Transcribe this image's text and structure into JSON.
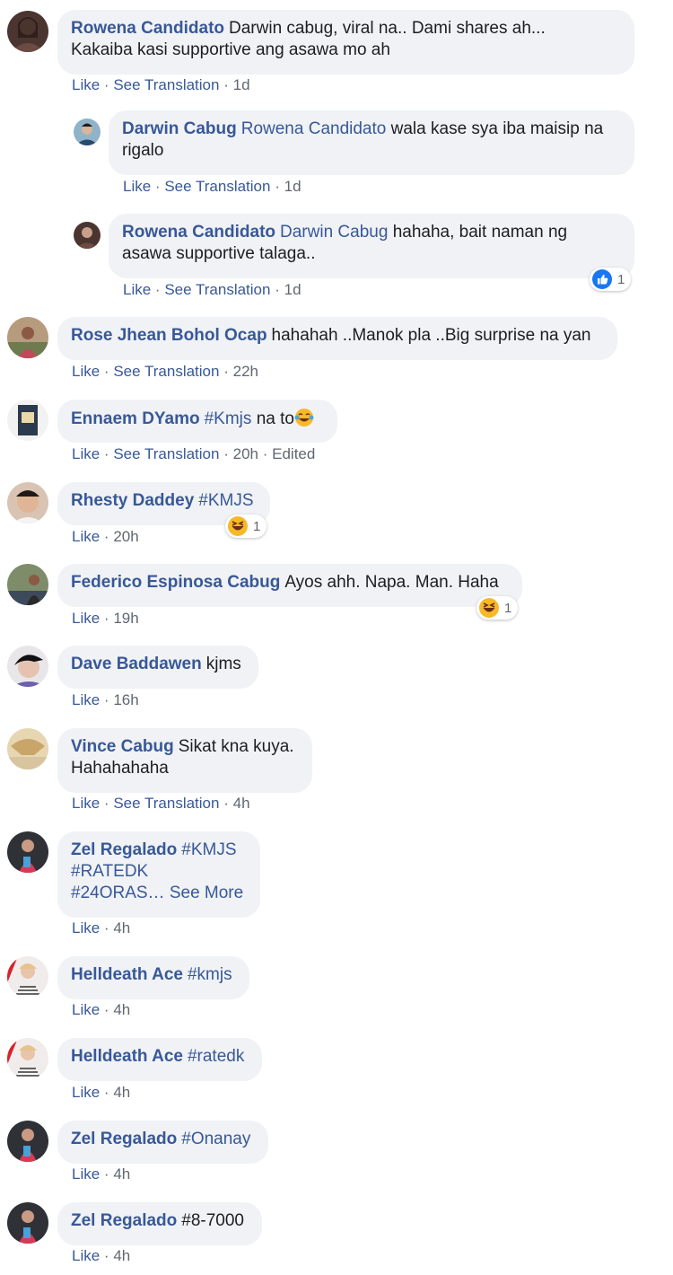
{
  "comments": [
    {
      "name": "Rowena Candidato",
      "text_line1": "Darwin cabug, viral na.. Dami shares ah...",
      "text_line2": "Kakaiba kasi supportive ang asawa mo ah",
      "like": "Like",
      "translate": "See Translation",
      "time": "1d"
    },
    {
      "name": "Darwin Cabug",
      "mention": "Rowena Candidato",
      "text_line1": "wala kase sya iba maisip na",
      "text_line2": "rigalo",
      "like": "Like",
      "translate": "See Translation",
      "time": "1d"
    },
    {
      "name": "Rowena Candidato",
      "mention": "Darwin Cabug",
      "text_line1": "hahaha, bait naman ng",
      "text_line2": "asawa supportive talaga..",
      "like": "Like",
      "translate": "See Translation",
      "time": "1d",
      "reaction_count": "1"
    },
    {
      "name": "Rose Jhean Bohol Ocap",
      "text": "hahahah ..Manok pla ..Big surprise na yan",
      "like": "Like",
      "translate": "See Translation",
      "time": "22h"
    },
    {
      "name": "Ennaem DYamo",
      "tag": "#Kmjs",
      "text": "na to",
      "like": "Like",
      "translate": "See Translation",
      "time": "20h",
      "edited": "Edited"
    },
    {
      "name": "Rhesty Daddey",
      "tag": "#KMJS",
      "like": "Like",
      "time": "20h",
      "reaction_count": "1"
    },
    {
      "name": "Federico Espinosa Cabug",
      "text": "Ayos ahh. Napa. Man. Haha",
      "like": "Like",
      "time": "19h",
      "reaction_count": "1"
    },
    {
      "name": "Dave Baddawen",
      "text": "kjms",
      "like": "Like",
      "time": "16h"
    },
    {
      "name": "Vince Cabug",
      "text_line1": "Sikat kna kuya.",
      "text_line2": "Hahahahaha",
      "like": "Like",
      "translate": "See Translation",
      "time": "4h"
    },
    {
      "name": "Zel Regalado",
      "tag1": "#KMJS",
      "tag2": "#RATEDK",
      "tag3": "#24ORAS…",
      "see_more": "See More",
      "like": "Like",
      "time": "4h"
    },
    {
      "name": "Helldeath Ace",
      "tag": "#kmjs",
      "like": "Like",
      "time": "4h"
    },
    {
      "name": "Helldeath Ace",
      "tag": "#ratedk",
      "like": "Like",
      "time": "4h"
    },
    {
      "name": "Zel Regalado",
      "tag": "#Onanay",
      "like": "Like",
      "time": "4h"
    },
    {
      "name": "Zel Regalado",
      "text": "#8-7000",
      "like": "Like",
      "time": "4h"
    }
  ],
  "separator": "·",
  "colors": {
    "link": "#385898",
    "bubble": "#f0f2f5",
    "meta": "#606770",
    "like_blue": "#1877f2",
    "haha_yellow": "#f7b928"
  }
}
